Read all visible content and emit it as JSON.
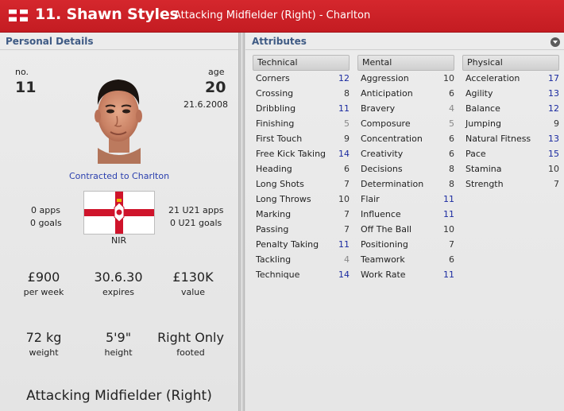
{
  "header": {
    "title": "11. Shawn Styles",
    "subtitle": "Attacking Midfielder (Right) - Charlton"
  },
  "personal": {
    "section_title": "Personal Details",
    "no_label": "no.",
    "no_value": "11",
    "age_label": "age",
    "age_value": "20",
    "dob": "21.6.2008",
    "contract": "Contracted to Charlton",
    "apps": "0 apps",
    "goals": "0 goals",
    "u21_apps": "21 U21 apps",
    "u21_goals": "0 U21 goals",
    "nationality": "NIR",
    "wage_value": "£900",
    "wage_label": "per week",
    "expires_value": "30.6.30",
    "expires_label": "expires",
    "value_value": "£130K",
    "value_label": "value",
    "weight_value": "72 kg",
    "weight_label": "weight",
    "height_value": "5'9\"",
    "height_label": "height",
    "footed_value": "Right Only",
    "footed_label": "footed",
    "position": "Attacking Midfielder (Right)"
  },
  "attributes": {
    "section_title": "Attributes",
    "technical": {
      "title": "Technical",
      "items": [
        {
          "name": "Corners",
          "value": "12"
        },
        {
          "name": "Crossing",
          "value": "8"
        },
        {
          "name": "Dribbling",
          "value": "11"
        },
        {
          "name": "Finishing",
          "value": "5"
        },
        {
          "name": "First Touch",
          "value": "9"
        },
        {
          "name": "Free Kick Taking",
          "value": "14"
        },
        {
          "name": "Heading",
          "value": "6"
        },
        {
          "name": "Long Shots",
          "value": "7"
        },
        {
          "name": "Long Throws",
          "value": "10"
        },
        {
          "name": "Marking",
          "value": "7"
        },
        {
          "name": "Passing",
          "value": "7"
        },
        {
          "name": "Penalty Taking",
          "value": "11"
        },
        {
          "name": "Tackling",
          "value": "4"
        },
        {
          "name": "Technique",
          "value": "14"
        }
      ]
    },
    "mental": {
      "title": "Mental",
      "items": [
        {
          "name": "Aggression",
          "value": "10"
        },
        {
          "name": "Anticipation",
          "value": "6"
        },
        {
          "name": "Bravery",
          "value": "4"
        },
        {
          "name": "Composure",
          "value": "5"
        },
        {
          "name": "Concentration",
          "value": "6"
        },
        {
          "name": "Creativity",
          "value": "6"
        },
        {
          "name": "Decisions",
          "value": "8"
        },
        {
          "name": "Determination",
          "value": "8"
        },
        {
          "name": "Flair",
          "value": "11"
        },
        {
          "name": "Influence",
          "value": "11"
        },
        {
          "name": "Off The Ball",
          "value": "10"
        },
        {
          "name": "Positioning",
          "value": "7"
        },
        {
          "name": "Teamwork",
          "value": "6"
        },
        {
          "name": "Work Rate",
          "value": "11"
        }
      ]
    },
    "physical": {
      "title": "Physical",
      "items": [
        {
          "name": "Acceleration",
          "value": "17"
        },
        {
          "name": "Agility",
          "value": "13"
        },
        {
          "name": "Balance",
          "value": "12"
        },
        {
          "name": "Jumping",
          "value": "9"
        },
        {
          "name": "Natural Fitness",
          "value": "13"
        },
        {
          "name": "Pace",
          "value": "15"
        },
        {
          "name": "Stamina",
          "value": "10"
        },
        {
          "name": "Strength",
          "value": "7"
        }
      ]
    }
  }
}
